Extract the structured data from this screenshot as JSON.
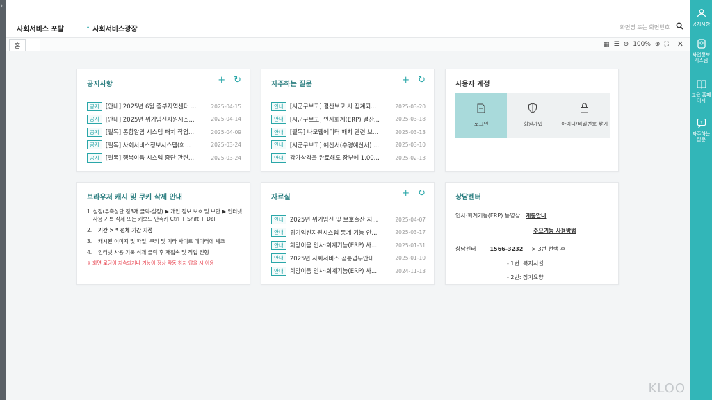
{
  "header": {
    "portal": "사회서비스 포탈",
    "plaza_bullet": "•",
    "plaza": "사회서비스광장",
    "search_placeholder": "화면명 또는 화면번호"
  },
  "tabs": {
    "home": "홈"
  },
  "tools": {
    "zoom": "100%"
  },
  "notice": {
    "title": "공지사항",
    "items": [
      {
        "badge": "공지",
        "text": "[안내] 2025년 6월 중부지역센터 ...",
        "date": "2025-04-15"
      },
      {
        "badge": "공지",
        "text": "[안내] 2025년 위기임신지원시스...",
        "date": "2025-04-14"
      },
      {
        "badge": "공지",
        "text": "[필독] 통합알림 시스템 패치 작업...",
        "date": "2025-04-09"
      },
      {
        "badge": "공지",
        "text": "[필독] 사회서비스정보시스템(희...",
        "date": "2025-03-24"
      },
      {
        "badge": "공지",
        "text": "[필독] 행복이음 시스템 중단 관련...",
        "date": "2025-03-24"
      }
    ]
  },
  "faq": {
    "title": "자주하는 질문",
    "items": [
      {
        "badge": "안내",
        "text": "[시군구보고] 결산보고 시 집계되...",
        "date": "2025-03-20"
      },
      {
        "badge": "안내",
        "text": "[시군구보고] 인사회계(ERP) 결산...",
        "date": "2025-03-18"
      },
      {
        "badge": "안내",
        "text": "[필독] 나모웹에디터 패치 관련 브...",
        "date": "2025-03-13"
      },
      {
        "badge": "안내",
        "text": "[시군구보고] 예산서(추경예산서) ...",
        "date": "2025-03-10"
      },
      {
        "badge": "안내",
        "text": "감가상각을 완료해도 장부에 1,00...",
        "date": "2025-02-13"
      }
    ]
  },
  "account": {
    "title": "사용자 계정",
    "login": "로그인",
    "signup": "회원가입",
    "find": "아이디/비밀번호 찾기"
  },
  "cache": {
    "title": "브라우저 캐시 및 쿠키 삭제 안내",
    "steps": [
      {
        "num": "1.",
        "text": "설정(우측상단 점3개 클릭-설정) ▶ 개인 정보 보호 및 보안 ▶ 인터넷 사용 기록 삭제 또는 키보드 단축키 Ctrl + Shift + Del"
      },
      {
        "num": "2.",
        "text": "기간 > * 전체 기간 지정"
      },
      {
        "num": "3.",
        "text": "캐시된 이미지 및 파일, 쿠키 및 기타 사이트 데이터에 체크"
      },
      {
        "num": "4.",
        "text": "인터넷 사용 기록 삭제 클릭 후 재접속 및 작업 진행"
      }
    ],
    "warning": "※ 화면 로딩이 지속되거나 기능이 정상 작동 하지 않을 시 이용"
  },
  "materials": {
    "title": "자료실",
    "items": [
      {
        "badge": "안내",
        "text": "2025년 위기임신 및 보호출산 지...",
        "date": "2025-04-07"
      },
      {
        "badge": "안내",
        "text": "위기임신지원시스템 통계 기능 안...",
        "date": "2025-03-17"
      },
      {
        "badge": "안내",
        "text": "희망이음 인사·회계기능(ERP) 사...",
        "date": "2025-01-31"
      },
      {
        "badge": "안내",
        "text": "2025년 사회서비스 공통업무안내",
        "date": "2025-01-10"
      },
      {
        "badge": "안내",
        "text": "희망이음 인사·회계기능(ERP) 사...",
        "date": "2024-11-13"
      }
    ]
  },
  "center": {
    "title": "상담센터",
    "video_label": "인사·회계기능(ERP) 동영상",
    "intro_link": "개통안내",
    "guide_link": "주요기능 사용방법",
    "phone_label": "상담센터",
    "phone": "1566-3232",
    "select": "> 3번 선택 후",
    "opt1": "- 1번: 복지시설",
    "opt2": "- 2번: 장기요양"
  },
  "rightbar": {
    "items": [
      {
        "icon": "person-icon",
        "label": "공지사항"
      },
      {
        "icon": "system-icon",
        "label": "사업정보 시스템"
      },
      {
        "icon": "book-icon",
        "label": "교육 홈페이지"
      },
      {
        "icon": "help-icon",
        "label": "자주하는 질문"
      }
    ]
  },
  "watermark": "KLOO"
}
